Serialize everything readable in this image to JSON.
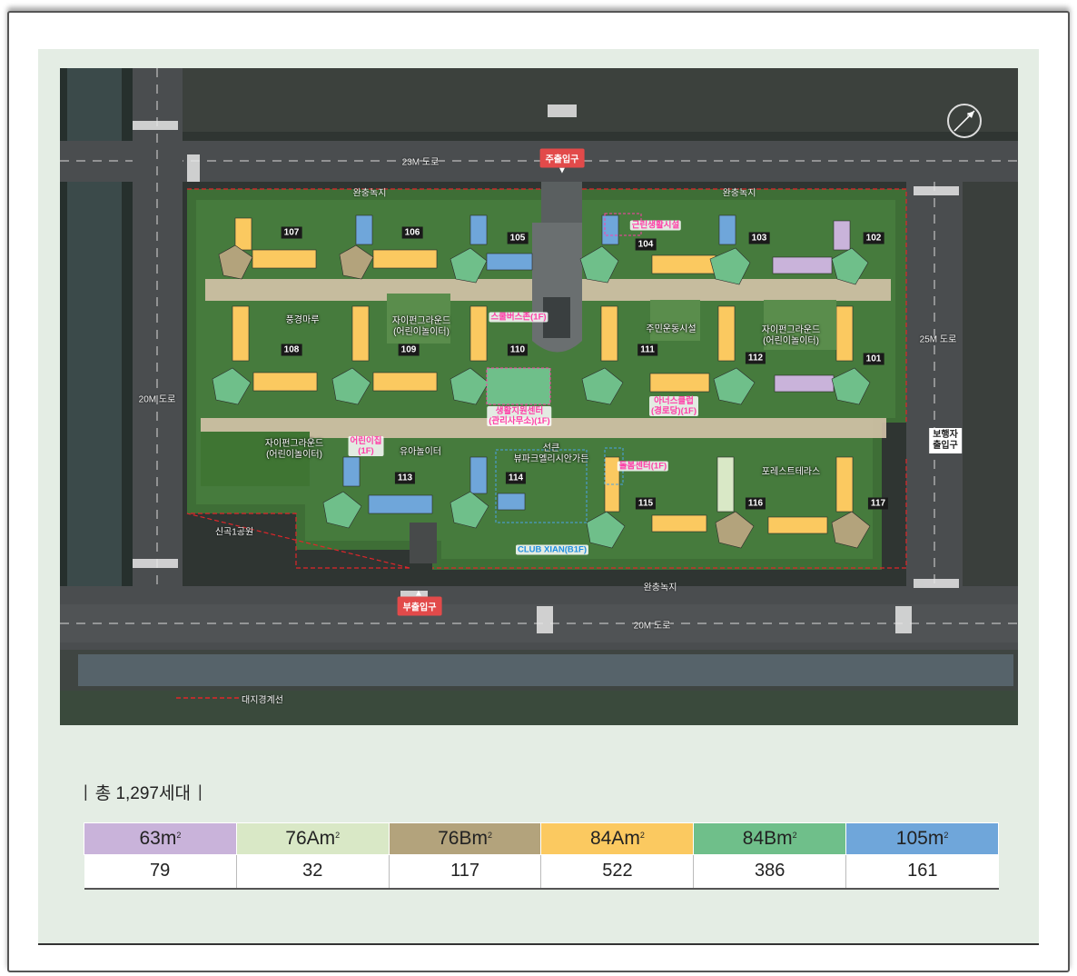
{
  "map": {
    "roads": {
      "north": "23M 도로",
      "east": "25M 도로",
      "west": "20M 도로",
      "south": "20M 도로"
    },
    "gates": {
      "main": "주출입구",
      "sub": "부출입구",
      "pedestrian": "보행자\n출입구"
    },
    "buffer_green": "완충녹지",
    "park": "신곡1공원",
    "boundary_legend": "대지경계선",
    "facilities": {
      "fountain_pond": "풍경마루",
      "playground_109": "자이펀그라운드\n(어린이놀이터)",
      "playground_112": "자이펀그라운드\n(어린이놀이터)",
      "playground_113": "자이펀그라운드\n(어린이놀이터)",
      "community": "주민운동시설",
      "toddler_play": "유아놀이터",
      "forest_terrace": "포레스트테라스",
      "central_garden": "선큰\n뷰파크엘리시안가든"
    },
    "highlighted": {
      "retail": "근린생활시설",
      "school_bus": "스쿨버스존(1F)",
      "support_center": "생활지원센터\n(관리사무소)(1F)",
      "senior_club": "아너스클럽\n(경로당)(1F)",
      "daycare": "어린이집\n(1F)",
      "care_center": "돌봄센터(1F)",
      "club": "CLUB XIAN(B1F)"
    },
    "buildings": [
      "101",
      "102",
      "103",
      "104",
      "105",
      "106",
      "107",
      "108",
      "109",
      "110",
      "111",
      "112",
      "113",
      "114",
      "115",
      "116",
      "117"
    ]
  },
  "summary": {
    "bar_left": "|",
    "text": "총 1,297세대",
    "bar_right": "|"
  },
  "unit_types": [
    {
      "name": "63m",
      "unit": "2",
      "count": "79",
      "color": "#c9b3da"
    },
    {
      "name": "76Am",
      "unit": "2",
      "count": "32",
      "color": "#d9e8c6"
    },
    {
      "name": "76Bm",
      "unit": "2",
      "count": "117",
      "color": "#b3a37c"
    },
    {
      "name": "84Am",
      "unit": "2",
      "count": "522",
      "color": "#fbc960"
    },
    {
      "name": "84Bm",
      "unit": "2",
      "count": "386",
      "color": "#6fbf8a"
    },
    {
      "name": "105m",
      "unit": "2",
      "count": "161",
      "color": "#6fa6da"
    }
  ],
  "colors": {
    "panel_bg": "#e4ede4",
    "gate_red": "#e24a4a",
    "highlight_pink": "#ff3fa8",
    "site_green": "#3f7a35",
    "walkway": "#d9c8b0"
  }
}
